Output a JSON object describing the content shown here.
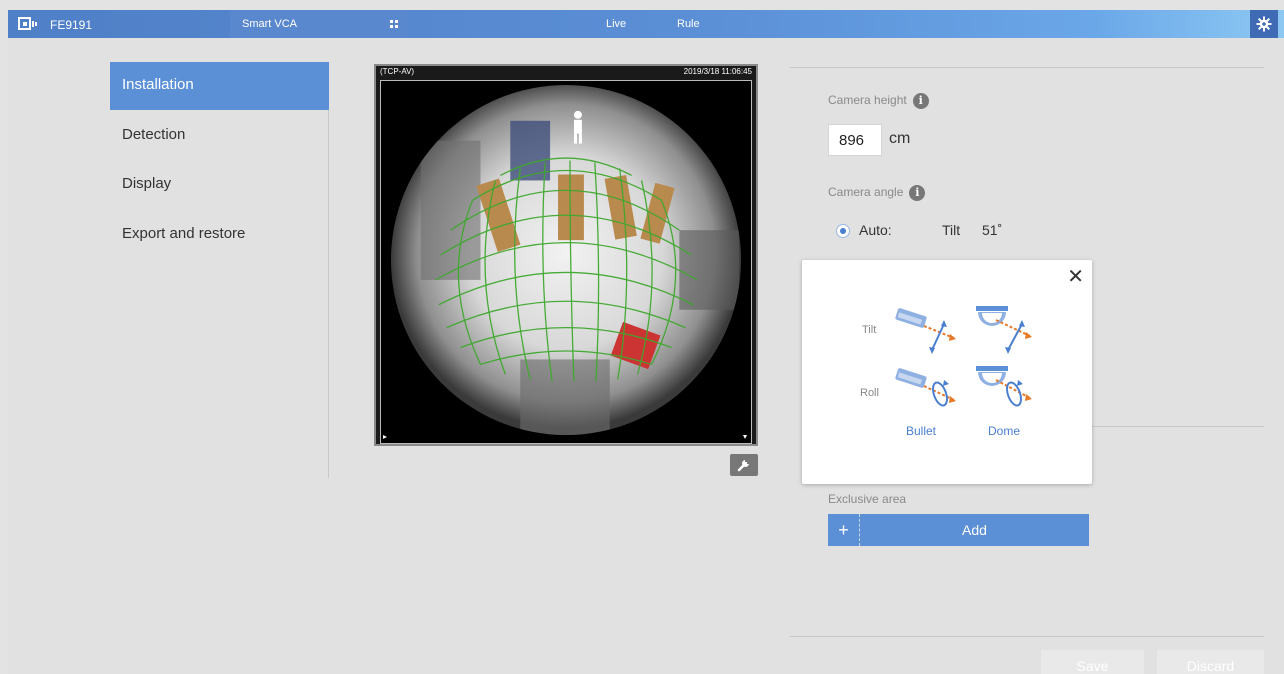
{
  "header": {
    "model": "FE9191",
    "app_tab": "Smart VCA",
    "nav": [
      "Live",
      "Rule"
    ],
    "brand_color": "#5b8fd6",
    "icons": [
      "camera-logo-icon",
      "apps-grid-icon",
      "gear-icon"
    ]
  },
  "sidebar": {
    "items": [
      {
        "label": "Installation",
        "active": true
      },
      {
        "label": "Detection",
        "active": false
      },
      {
        "label": "Display",
        "active": false
      },
      {
        "label": "Export and restore",
        "active": false
      }
    ]
  },
  "video": {
    "stream_label": "(TCP-AV)",
    "timestamp": "2019/3/18 11:06:45"
  },
  "camera_height": {
    "label": "Camera height",
    "value": "896",
    "unit": "cm"
  },
  "camera_angle": {
    "label": "Camera angle",
    "mode_label": "Auto:",
    "tilt_label": "Tilt",
    "tilt_value": "51˚"
  },
  "help_popup": {
    "row_labels": [
      "Tilt",
      "Roll"
    ],
    "col_labels": [
      "Bullet",
      "Dome"
    ]
  },
  "exclusive_area": {
    "label": "Exclusive area",
    "add_label": "Add"
  },
  "footer": {
    "save_label": "Save",
    "discard_label": "Discard"
  }
}
